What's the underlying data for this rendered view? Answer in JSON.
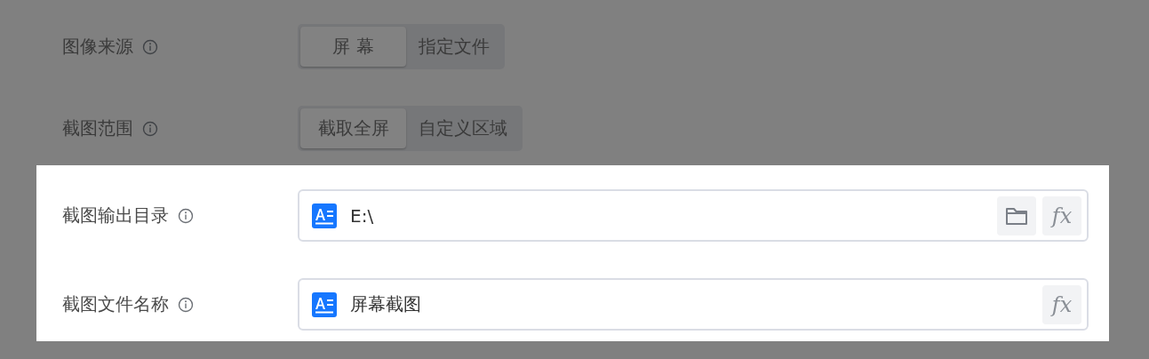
{
  "rows": [
    {
      "label": "图像来源",
      "kind": "segmented",
      "spotlight": false,
      "options": [
        {
          "label": "屏 幕",
          "selected": true
        },
        {
          "label": "指定文件",
          "selected": false
        }
      ]
    },
    {
      "label": "截图范围",
      "kind": "segmented",
      "spotlight": false,
      "options": [
        {
          "label": "截取全屏",
          "selected": true
        },
        {
          "label": "自定义区域",
          "selected": false
        }
      ]
    },
    {
      "label": "截图输出目录",
      "kind": "input",
      "spotlight": true,
      "value": "E:\\",
      "folder_button": true,
      "formula_button": "fx"
    },
    {
      "label": "截图文件名称",
      "kind": "input",
      "spotlight": true,
      "value": "屏幕截图",
      "folder_button": false,
      "formula_button": "fx"
    }
  ]
}
